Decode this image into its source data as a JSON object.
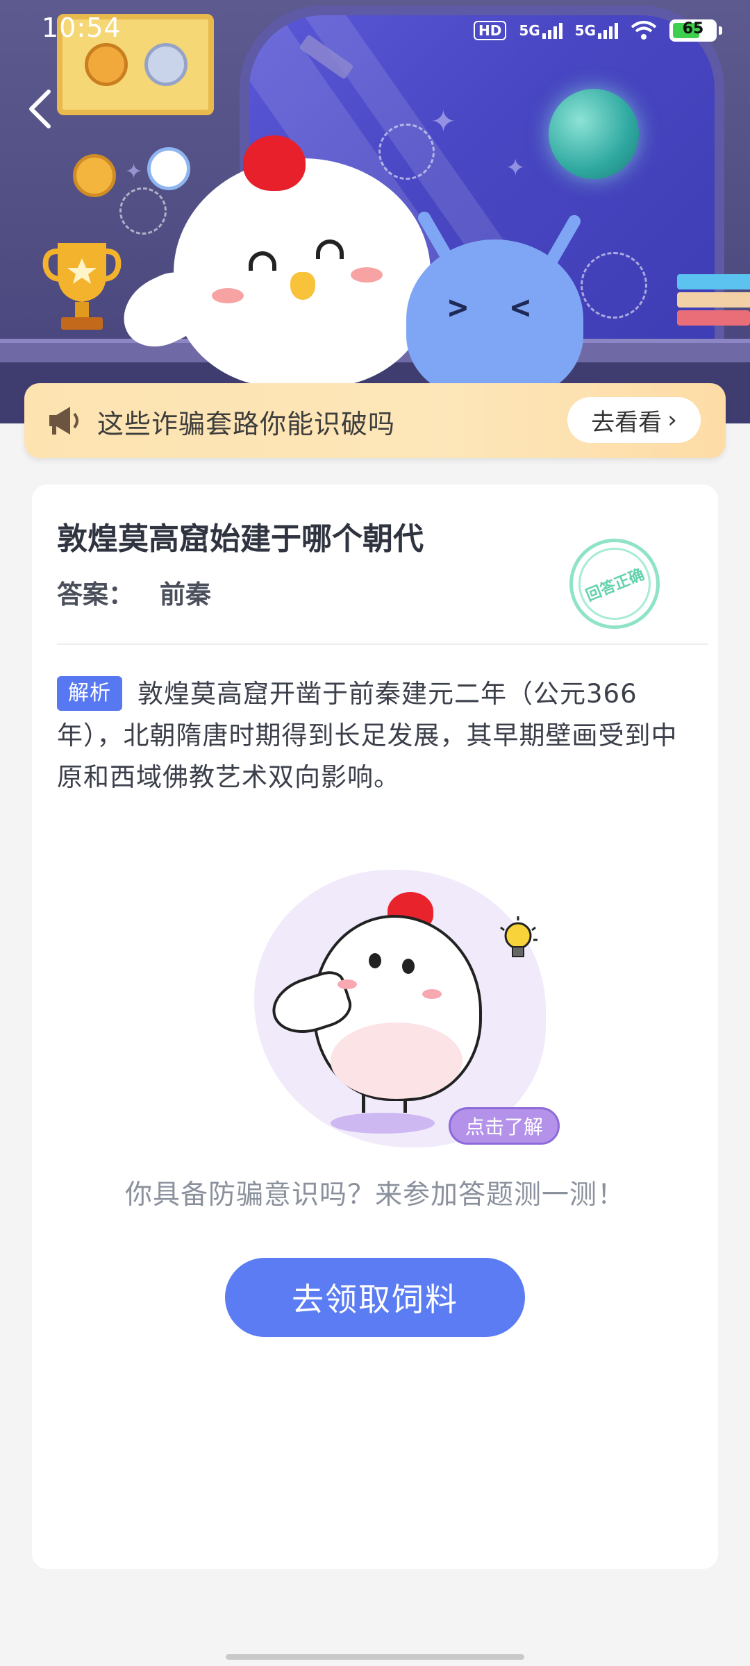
{
  "status_bar": {
    "time": "10:54",
    "hd": "HD",
    "net1": "5G",
    "net2": "5G",
    "battery": "65"
  },
  "notice": {
    "text": "这些诈骗套路你能识破吗",
    "button_label": "去看看",
    "icon": "megaphone-icon"
  },
  "card": {
    "question": "敦煌莫高窟始建于哪个朝代",
    "answer_label": "答案：",
    "answer_value": "前秦",
    "stamp_text": "回答正确",
    "analysis_tag": "解析",
    "analysis_text": "敦煌莫高窟开凿于前秦建元二年（公元366年），北朝隋唐时期得到长足发展，其早期壁画受到中原和西域佛教艺术双向影响。",
    "illustration_tag": "点击了解",
    "prompt": "你具备防骗意识吗？来参加答题测一测！",
    "cta_label": "去领取饲料"
  },
  "colors": {
    "accent": "#5b7cf2",
    "tag_blue": "#5878f2",
    "banner_bg": "#fde3b0",
    "stamp_green": "#63d2ab",
    "hero_bg": "#5d5a8f"
  }
}
